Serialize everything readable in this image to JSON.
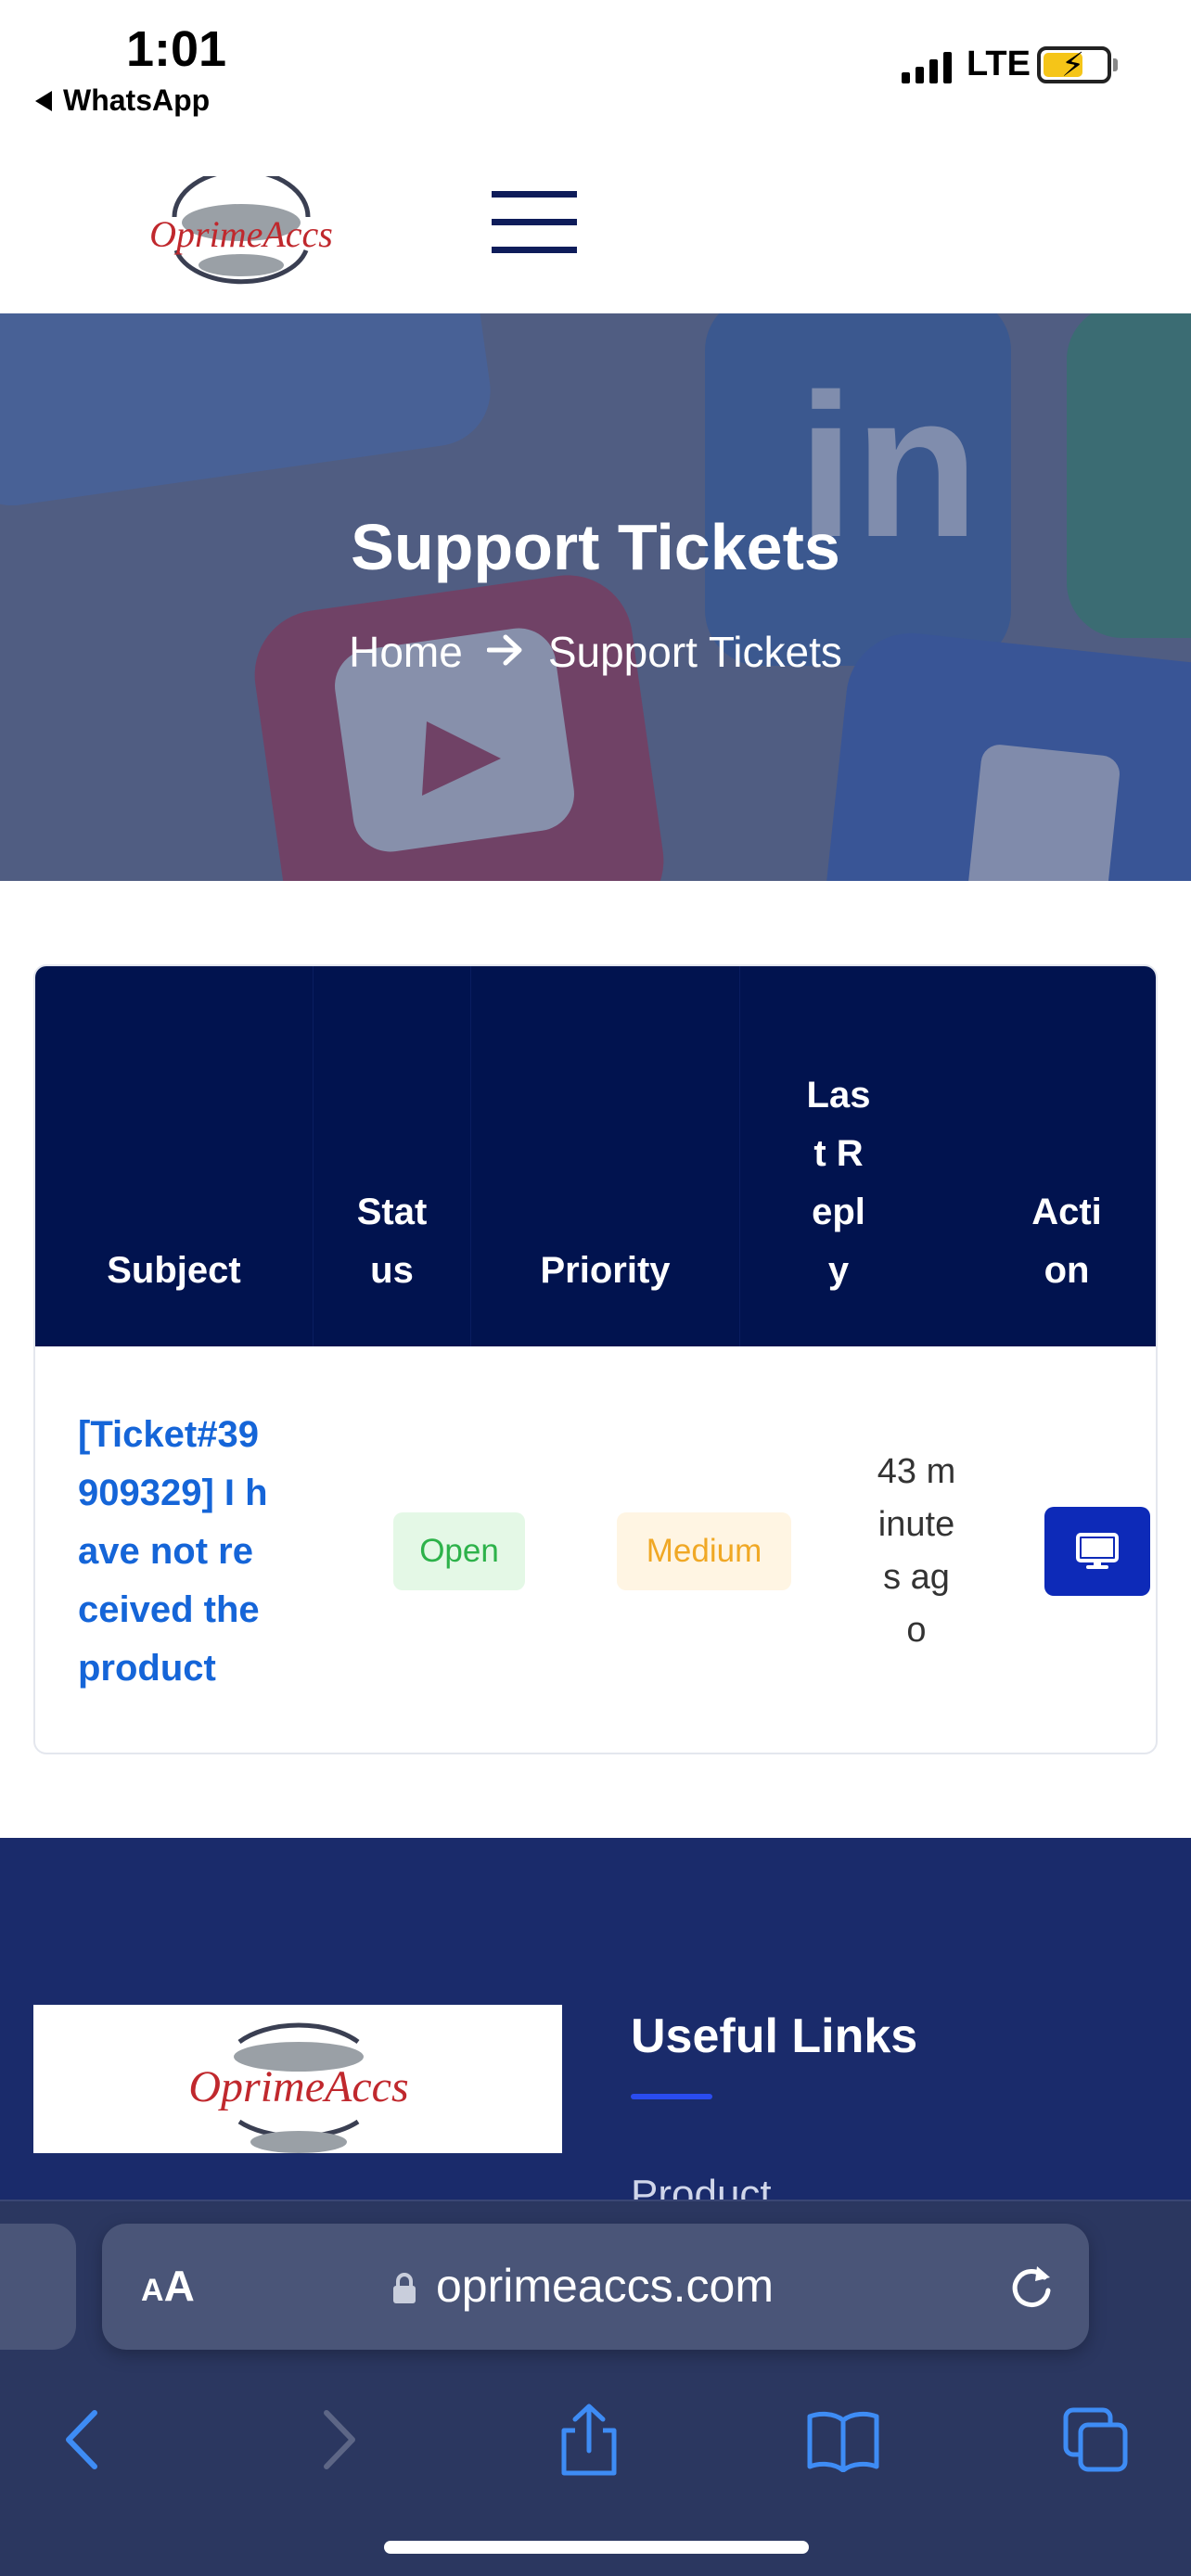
{
  "status_bar": {
    "time": "1:01",
    "back_app": "WhatsApp",
    "network": "LTE"
  },
  "header": {
    "logo_text": "OprimeAccs",
    "menu_icon": "hamburger-icon"
  },
  "hero": {
    "title": "Support Tickets",
    "breadcrumb": {
      "home": "Home",
      "separator_icon": "arrow-right-icon",
      "current": "Support Tickets"
    }
  },
  "tickets_table": {
    "columns": [
      "Subject",
      "Status",
      "Priority",
      "Last Reply",
      "Action"
    ],
    "rows": [
      {
        "subject": "[Ticket#39909329] I have not received the product",
        "status": "Open",
        "priority": "Medium",
        "last_reply": "43 minutes ago",
        "action_icon": "desktop-icon"
      }
    ]
  },
  "footer": {
    "logo_text": "OprimeAccs",
    "useful_links_heading": "Useful Links",
    "links": [
      "Product"
    ]
  },
  "browser": {
    "aa_small": "A",
    "aa_big": "A",
    "url": "oprimeaccs.com",
    "toolbar_icons": [
      "back-icon",
      "forward-icon",
      "share-icon",
      "bookmarks-icon",
      "tabs-icon"
    ]
  },
  "colors": {
    "navy": "#01134f",
    "link_blue": "#1565d8",
    "open_green": "#2db24a",
    "medium_orange": "#f0a825",
    "action_blue": "#0d2ab8",
    "footer_bg": "#1a2b6b",
    "logo_red": "#c0282d"
  }
}
